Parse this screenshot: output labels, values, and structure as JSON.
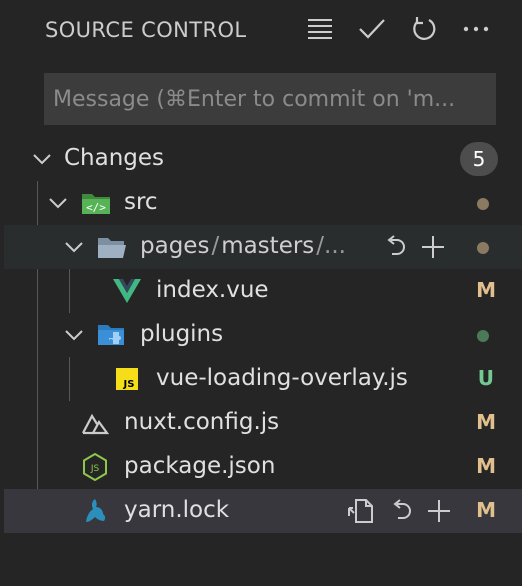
{
  "header": {
    "title": "SOURCE CONTROL",
    "icons": [
      "view-as-list-icon",
      "commit-check-icon",
      "refresh-icon",
      "more-actions-icon"
    ]
  },
  "commit_message": {
    "value": "",
    "placeholder": "Message (⌘Enter to commit on 'm..."
  },
  "changes": {
    "label": "Changes",
    "count": "5"
  },
  "tree": {
    "src": {
      "label": "src"
    },
    "pages": {
      "segments": [
        "pages",
        "/",
        "masters",
        "/..."
      ]
    },
    "index_vue": {
      "label": "index.vue",
      "status": "M"
    },
    "plugins": {
      "label": "plugins"
    },
    "vue_loading": {
      "label": "vue-loading-overlay.js",
      "status": "U"
    },
    "nuxt_config": {
      "label": "nuxt.config.js",
      "status": "M"
    },
    "package_json": {
      "label": "package.json",
      "status": "M"
    },
    "yarn_lock": {
      "label": "yarn.lock",
      "status": "M"
    }
  },
  "colors": {
    "modified": "#e2c08d",
    "untracked": "#73c991",
    "dot_modified": "#8a7a61",
    "dot_added": "#4b7a58",
    "vue": "#41b883",
    "js": "#f5de19",
    "node": "#8cc84b",
    "yarn": "#2c8ebb"
  }
}
